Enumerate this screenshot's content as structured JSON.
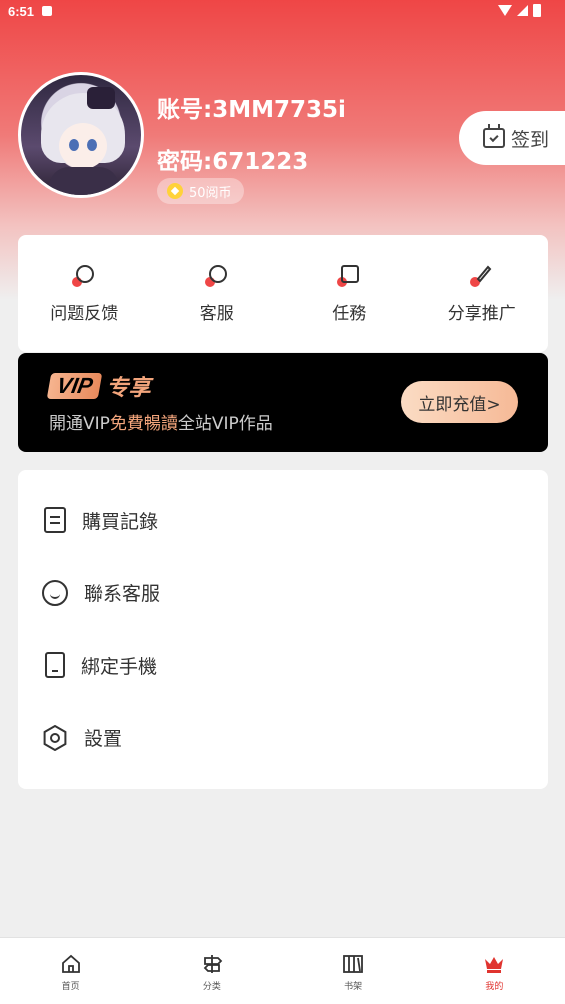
{
  "status_bar": {
    "time": "6:51"
  },
  "profile": {
    "account": "账号:3MM7735i",
    "password": "密码:671223",
    "coins": "50阅币"
  },
  "signin": {
    "label": "签到"
  },
  "quick_actions": [
    {
      "label": "问题反馈",
      "icon": "feedback-icon"
    },
    {
      "label": "客服",
      "icon": "customer-service-icon"
    },
    {
      "label": "任務",
      "icon": "task-icon"
    },
    {
      "label": "分享推广",
      "icon": "rocket-icon"
    }
  ],
  "vip": {
    "badge": "VIP",
    "title": "专享",
    "desc_prefix": "開通VIP",
    "desc_highlight": "免費暢讀",
    "desc_suffix": "全站VIP作品",
    "button": "立即充值>"
  },
  "menu": [
    {
      "label": "購買記錄",
      "icon": "document-icon"
    },
    {
      "label": "聯系客服",
      "icon": "chat-icon"
    },
    {
      "label": "綁定手機",
      "icon": "phone-icon"
    },
    {
      "label": "設置",
      "icon": "settings-icon"
    }
  ],
  "bottom_nav": [
    {
      "label": "首页",
      "icon": "home-icon"
    },
    {
      "label": "分类",
      "icon": "signpost-icon"
    },
    {
      "label": "书架",
      "icon": "bookshelf-icon"
    },
    {
      "label": "我的",
      "icon": "crown-icon"
    }
  ],
  "colors": {
    "brand_red": "#ef4646",
    "vip_orange": "#f3a57c",
    "active_nav": "#e0342f"
  }
}
